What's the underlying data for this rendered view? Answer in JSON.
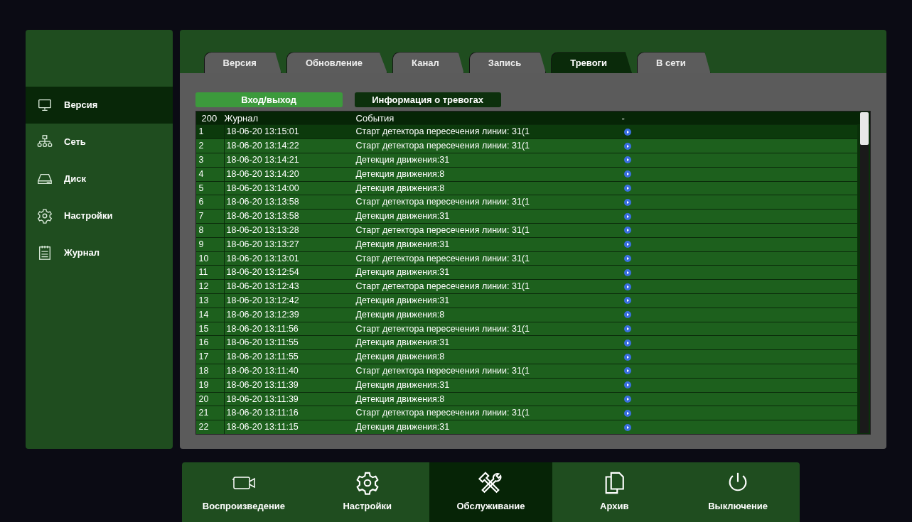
{
  "sidebar": {
    "items": [
      {
        "label": "Версия",
        "selected": true
      },
      {
        "label": "Сеть",
        "selected": false
      },
      {
        "label": "Диск",
        "selected": false
      },
      {
        "label": "Настройки",
        "selected": false
      },
      {
        "label": "Журнал",
        "selected": false
      }
    ]
  },
  "tabs": [
    {
      "label": "Версия",
      "selected": false
    },
    {
      "label": "Обновление",
      "selected": false
    },
    {
      "label": "Канал",
      "selected": false
    },
    {
      "label": "Запись",
      "selected": false
    },
    {
      "label": "Тревоги",
      "selected": true
    },
    {
      "label": "В сети",
      "selected": false
    }
  ],
  "subtabs": [
    {
      "label": "Вход/выход",
      "selected": false
    },
    {
      "label": "Информация о тревогах",
      "selected": true
    }
  ],
  "table": {
    "columns": [
      "200",
      "Журнал",
      "События",
      "-"
    ],
    "rows": [
      {
        "n": "1",
        "time": "18-06-20 13:15:01",
        "event": "Старт детектора пересечения линии: 31(1",
        "selected": true
      },
      {
        "n": "2",
        "time": "18-06-20 13:14:22",
        "event": "Старт детектора пересечения линии: 31(1",
        "selected": false
      },
      {
        "n": "3",
        "time": "18-06-20 13:14:21",
        "event": "Детекция движения:31",
        "selected": false
      },
      {
        "n": "4",
        "time": "18-06-20 13:14:20",
        "event": "Детекция движения:8",
        "selected": false
      },
      {
        "n": "5",
        "time": "18-06-20 13:14:00",
        "event": "Детекция движения:8",
        "selected": false
      },
      {
        "n": "6",
        "time": "18-06-20 13:13:58",
        "event": "Старт детектора пересечения линии: 31(1",
        "selected": false
      },
      {
        "n": "7",
        "time": "18-06-20 13:13:58",
        "event": "Детекция движения:31",
        "selected": false
      },
      {
        "n": "8",
        "time": "18-06-20 13:13:28",
        "event": "Старт детектора пересечения линии: 31(1",
        "selected": false
      },
      {
        "n": "9",
        "time": "18-06-20 13:13:27",
        "event": "Детекция движения:31",
        "selected": false
      },
      {
        "n": "10",
        "time": "18-06-20 13:13:01",
        "event": "Старт детектора пересечения линии: 31(1",
        "selected": false
      },
      {
        "n": "11",
        "time": "18-06-20 13:12:54",
        "event": "Детекция движения:31",
        "selected": false
      },
      {
        "n": "12",
        "time": "18-06-20 13:12:43",
        "event": "Старт детектора пересечения линии: 31(1",
        "selected": false
      },
      {
        "n": "13",
        "time": "18-06-20 13:12:42",
        "event": "Детекция движения:31",
        "selected": false
      },
      {
        "n": "14",
        "time": "18-06-20 13:12:39",
        "event": "Детекция движения:8",
        "selected": false
      },
      {
        "n": "15",
        "time": "18-06-20 13:11:56",
        "event": "Старт детектора пересечения линии: 31(1",
        "selected": false
      },
      {
        "n": "16",
        "time": "18-06-20 13:11:55",
        "event": "Детекция движения:31",
        "selected": false
      },
      {
        "n": "17",
        "time": "18-06-20 13:11:55",
        "event": "Детекция движения:8",
        "selected": false
      },
      {
        "n": "18",
        "time": "18-06-20 13:11:40",
        "event": "Старт детектора пересечения линии: 31(1",
        "selected": false
      },
      {
        "n": "19",
        "time": "18-06-20 13:11:39",
        "event": "Детекция движения:31",
        "selected": false
      },
      {
        "n": "20",
        "time": "18-06-20 13:11:39",
        "event": "Детекция движения:8",
        "selected": false
      },
      {
        "n": "21",
        "time": "18-06-20 13:11:16",
        "event": "Старт детектора пересечения линии: 31(1",
        "selected": false
      },
      {
        "n": "22",
        "time": "18-06-20 13:11:15",
        "event": "Детекция движения:31",
        "selected": false
      }
    ]
  },
  "dock": [
    {
      "label": "Воспроизведение",
      "selected": false
    },
    {
      "label": "Настройки",
      "selected": false
    },
    {
      "label": "Обслуживание",
      "selected": true
    },
    {
      "label": "Архив",
      "selected": false
    },
    {
      "label": "Выключение",
      "selected": false
    }
  ]
}
